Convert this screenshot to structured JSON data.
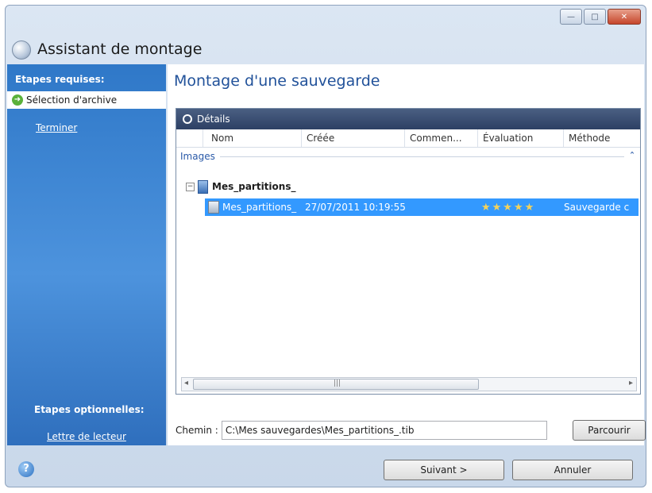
{
  "window": {
    "title": "Assistant de montage",
    "controls": [
      "minimize-icon",
      "maximize-icon",
      "close-icon"
    ]
  },
  "sidebar": {
    "required_heading": "Etapes requises:",
    "current_step": "Sélection d'archive",
    "finish_link": "Terminer",
    "optional_heading": "Etapes optionnelles:",
    "drive_letter_link": "Lettre de lecteur"
  },
  "main": {
    "title": "Montage d'une sauvegarde",
    "panel_title": "Détails",
    "columns": [
      "Nom",
      "Créée",
      "Commen...",
      "Évaluation",
      "Méthode"
    ],
    "group_label": "Images",
    "tree": {
      "name": "Mes_partitions_"
    },
    "selected_row": {
      "name": "Mes_partitions_",
      "created": "27/07/2011 10:19:55",
      "comment": "",
      "rating_stars": 5,
      "method": "Sauvegarde c"
    },
    "path_label": "Chemin :",
    "path_value": "C:\\Mes sauvegardes\\Mes_partitions_.tib",
    "browse_label": "Parcourir"
  },
  "footer": {
    "help_icon": "help-icon",
    "next_label": "Suivant >",
    "cancel_label": "Annuler"
  },
  "colors": {
    "sidebar_blue": "#2f78c8",
    "title_blue": "#22529a",
    "selection_blue": "#3399ff",
    "panel_header": "#2d4064"
  }
}
